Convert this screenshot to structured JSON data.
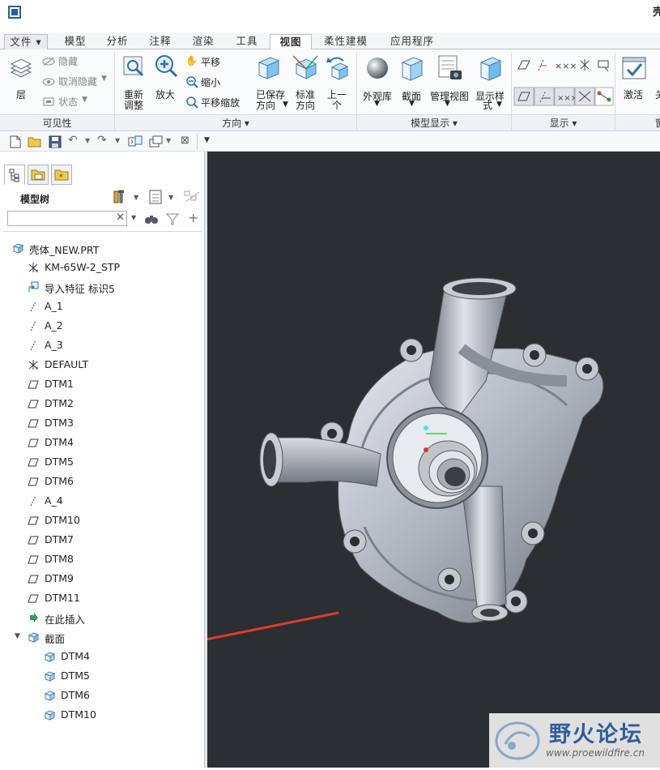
{
  "window": {
    "title": "壳"
  },
  "tabs": [
    {
      "label": "文件 ▾"
    },
    {
      "label": "模型"
    },
    {
      "label": "分析"
    },
    {
      "label": "注释"
    },
    {
      "label": "渲染"
    },
    {
      "label": "工具"
    },
    {
      "label": "视图"
    },
    {
      "label": "柔性建模"
    },
    {
      "label": "应用程序"
    }
  ],
  "ribbon": {
    "visibility": {
      "layer": "层",
      "hide": "隐藏",
      "unhide": "取消隐藏",
      "status": "状态",
      "group": "可见性"
    },
    "orientation": {
      "refit_1": "重新",
      "refit_2": "调整",
      "zoom_in": "放大",
      "pan": "平移",
      "zoom_out": "缩小",
      "pan_zoom": "平移缩放",
      "saved_1": "已保存",
      "saved_2": "方向",
      "standard_1": "标准",
      "standard_2": "方向",
      "prev_1": "上一",
      "prev_2": "个",
      "group": "方向"
    },
    "model_display": {
      "appearance": "外观库",
      "section": "截面",
      "manage_views": "管理视图",
      "display_1": "显示样",
      "display_2": "式",
      "group": "模型显示"
    },
    "show": {
      "group": "显示"
    },
    "activate": {
      "label": "激活",
      "extra": "关",
      "group_extra": "窗"
    }
  },
  "navigator": {
    "header": "模型树"
  },
  "tree": [
    {
      "label": "壳体_NEW.PRT",
      "icon": "part-icon"
    },
    {
      "label": "KM-65W-2_STP",
      "icon": "csys-icon"
    },
    {
      "label": "导入特征 标识5",
      "icon": "import-feature-icon"
    },
    {
      "label": "A_1",
      "icon": "axis-icon"
    },
    {
      "label": "A_2",
      "icon": "axis-icon"
    },
    {
      "label": "A_3",
      "icon": "axis-icon"
    },
    {
      "label": "DEFAULT",
      "icon": "csys-icon"
    },
    {
      "label": "DTM1",
      "icon": "datum-plane-icon"
    },
    {
      "label": "DTM2",
      "icon": "datum-plane-icon"
    },
    {
      "label": "DTM3",
      "icon": "datum-plane-icon"
    },
    {
      "label": "DTM4",
      "icon": "datum-plane-icon"
    },
    {
      "label": "DTM5",
      "icon": "datum-plane-icon"
    },
    {
      "label": "DTM6",
      "icon": "datum-plane-icon"
    },
    {
      "label": "A_4",
      "icon": "axis-icon"
    },
    {
      "label": "DTM10",
      "icon": "datum-plane-icon"
    },
    {
      "label": "DTM7",
      "icon": "datum-plane-icon"
    },
    {
      "label": "DTM8",
      "icon": "datum-plane-icon"
    },
    {
      "label": "DTM9",
      "icon": "datum-plane-icon"
    },
    {
      "label": "DTM11",
      "icon": "datum-plane-icon"
    },
    {
      "label": "在此插入",
      "icon": "insert-here-icon"
    },
    {
      "label": "截面",
      "icon": "section-folder-icon"
    },
    {
      "label": "DTM4",
      "icon": "section-icon"
    },
    {
      "label": "DTM5",
      "icon": "section-icon"
    },
    {
      "label": "DTM6",
      "icon": "section-icon"
    },
    {
      "label": "DTM10",
      "icon": "section-icon"
    }
  ],
  "colors": {
    "viewport_bg": "#2b2f31",
    "annotation_arrow": "#e23b34",
    "model": "#b4bac4"
  },
  "watermark": {
    "title": "野火论坛",
    "url": "www.proewildfire.cn"
  }
}
